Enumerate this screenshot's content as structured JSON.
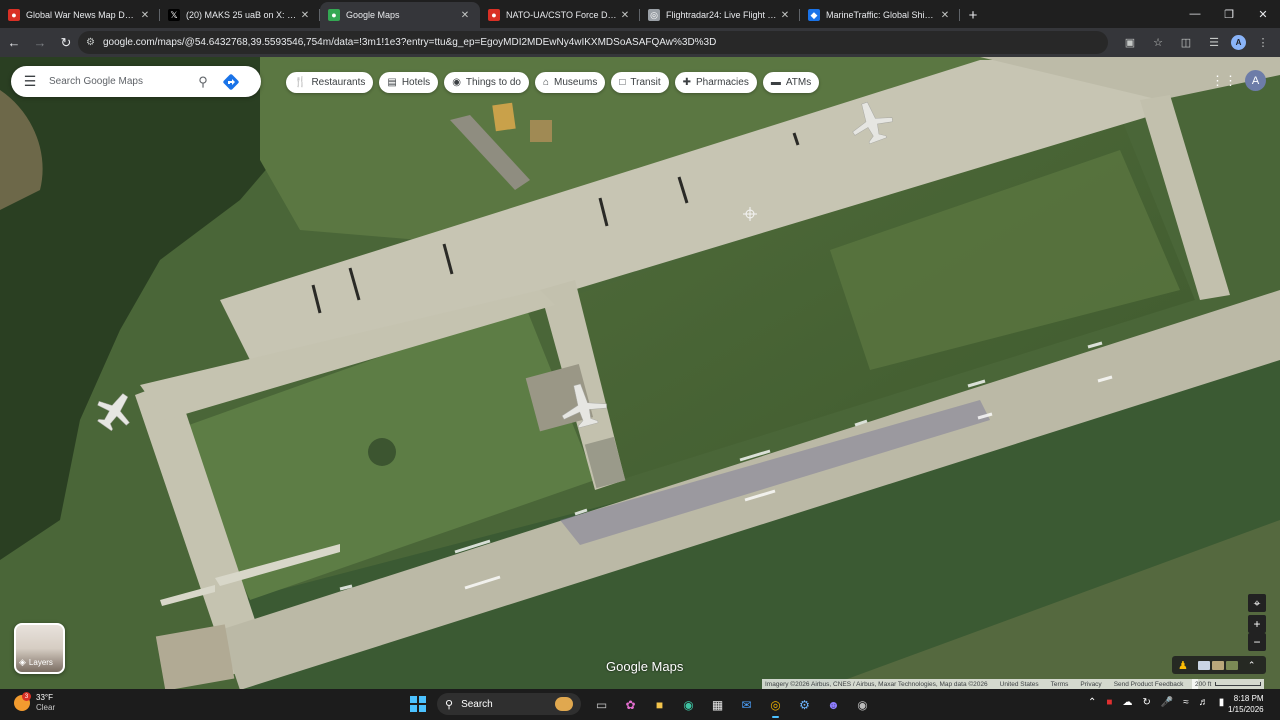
{
  "browser": {
    "tabs": [
      {
        "title": "Global War News Map Day 142",
        "icon": "maps-pin-icon",
        "color": "#d93025",
        "active": false
      },
      {
        "title": "(20) MAKS 25 uaВ on X: \"В ...",
        "icon": "x-logo-icon",
        "color": "#000000",
        "active": false
      },
      {
        "title": "Google Maps",
        "icon": "google-maps-icon",
        "color": "#34a853",
        "active": true
      },
      {
        "title": "NATO-UA/CSTO Force Disposit...",
        "icon": "maps-pin-icon",
        "color": "#d93025",
        "active": false
      },
      {
        "title": "Flightradar24: Live Flight Track...",
        "icon": "radar-icon",
        "color": "#9aa0a6",
        "active": false
      },
      {
        "title": "MarineTraffic: Global Ship Track...",
        "icon": "ship-icon",
        "color": "#1a73e8",
        "active": false
      }
    ],
    "url": "google.com/maps/@54.6432768,39.5593546,754m/data=!3m1!1e3?entry=ttu&g_ep=EgoyMDI2MDEwNy4wIKXMDSoASAFQAw%3D%3D",
    "profile_initial": "A"
  },
  "maps": {
    "search_placeholder": "Search Google Maps",
    "chips": [
      {
        "label": "Restaurants",
        "icon": "fork-knife-icon"
      },
      {
        "label": "Hotels",
        "icon": "bed-icon"
      },
      {
        "label": "Things to do",
        "icon": "camera-icon"
      },
      {
        "label": "Museums",
        "icon": "museum-icon"
      },
      {
        "label": "Transit",
        "icon": "train-icon"
      },
      {
        "label": "Pharmacies",
        "icon": "pharmacy-icon"
      },
      {
        "label": "ATMs",
        "icon": "atm-icon"
      }
    ],
    "account_initial": "A",
    "layers_label": "Layers",
    "logo_text": "Google Maps",
    "attribution": "Imagery ©2026 Airbus, CNES / Airbus, Maxar Technologies, Map data ©2026",
    "footer_links": [
      "United States",
      "Terms",
      "Privacy",
      "Send Product Feedback"
    ],
    "scale_label": "200 ft"
  },
  "taskbar": {
    "temperature": "33°F",
    "condition": "Clear",
    "weather_badge": "3",
    "search_label": "Search",
    "time": "8:18 PM",
    "date": "1/15/2026"
  }
}
